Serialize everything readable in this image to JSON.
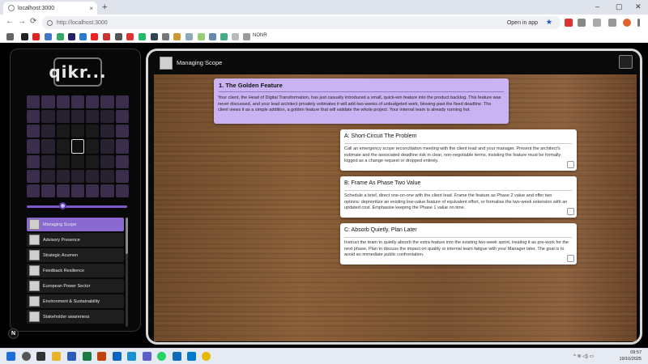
{
  "browser": {
    "tab_title": "localhost:3000",
    "url": "http://localhost:3000",
    "open_in_app": "Open in app",
    "bookmark_folder": "NONR",
    "new_tab": "+",
    "tab_close": "×",
    "win_min": "–",
    "win_max": "▢",
    "win_close": "✕",
    "back": "←",
    "forward": "→",
    "reload": "⟳",
    "star": "★",
    "down_arrow": "⌄"
  },
  "sidebar": {
    "logo": "qikr...",
    "slider_value": 0.35,
    "nav_items": [
      {
        "label": "Managing Scope",
        "active": true
      },
      {
        "label": "Advisory Presence",
        "active": false
      },
      {
        "label": "Strategic Acumen",
        "active": false
      },
      {
        "label": "Feedback Resilience",
        "active": false
      },
      {
        "label": "European Power Sector",
        "active": false
      },
      {
        "label": "Environment & Sustainability",
        "active": false
      },
      {
        "label": "Stakeholder awareness",
        "active": false
      }
    ],
    "badge": "N"
  },
  "main": {
    "title": "Managing Scope",
    "scenario": {
      "title": "1. The Golden Feature",
      "text": "Your client, the Head of Digital Transformation, has just casually introduced a small, quick-win feature into the product backlog. This feature was never discussed, and your lead architect privately estimates it will add two weeks of unbudgeted work, blowing past the fixed deadline. The client views it as a simple addition, a golden feature that will validate the whole project. Your internal team is already running hot."
    },
    "options": [
      {
        "title": "A: Short-Circuit The Problem",
        "text": "Call an emergency scope reconciliation meeting with the client lead and your manager. Present the architect's estimate and the associated deadline risk in clear, non-negotiable terms, insisting the feature must be formally logged as a change request or dropped entirely."
      },
      {
        "title": "B: Frame As Phase Two Value",
        "text": "Schedule a brief, direct one-on-one with the client lead. Frame the feature as Phase 2 value and offer two options: deprioritize an existing low-value feature of equivalent effort, or formalise the two-week extension with an updated cost. Emphasise keeping the Phase 1 value on time."
      },
      {
        "title": "C: Absorb Quietly, Plan Later",
        "text": "Instruct the team to quietly absorb the extra feature into the existing two-week sprint, treating it as pre-work for the next phase. Plan to discuss the impact on quality or internal team fatigue with your Manager later. The goal is to avoid an immediate public confrontation."
      }
    ]
  },
  "taskbar": {
    "time": "09:57",
    "date": "19/10/2025",
    "tray": "^ ≋ ◁) ▭"
  },
  "colors": {
    "accent": "#8a6ad0",
    "scenario_bg": "#c9b3f2"
  }
}
